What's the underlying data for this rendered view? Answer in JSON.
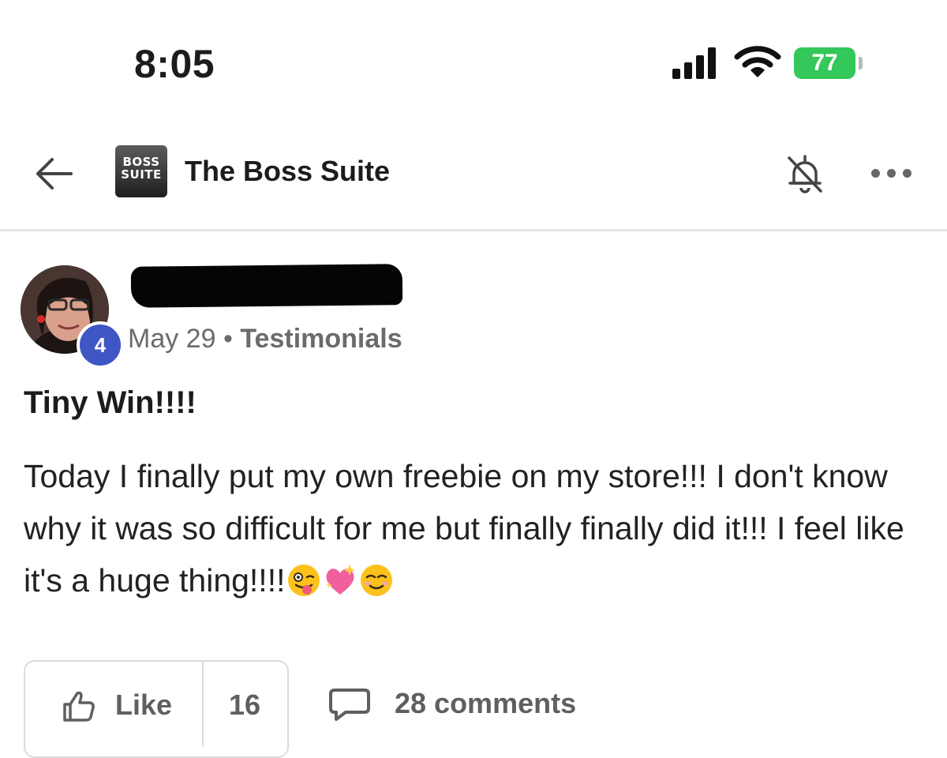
{
  "status_bar": {
    "time": "8:05",
    "battery_level": "77",
    "battery_color": "#34c759"
  },
  "header": {
    "back_icon": "arrow-left-icon",
    "group_logo_line1": "BOSS",
    "group_logo_line2": "SUITE",
    "group_name": "The Boss Suite",
    "bell_icon": "bell-muted-icon",
    "more_icon": "more-dots-icon"
  },
  "post": {
    "level": "4",
    "date": "May 29",
    "separator": "•",
    "category": "Testimonials",
    "title": "Tiny Win!!!!",
    "body": "Today I finally put my own freebie on my store!!! I don't know why it was so difficult for me but finally finally did it!!! I feel like it's a huge thing!!!!",
    "emojis": [
      "winking-face-with-tongue",
      "sparkling-heart",
      "smiling-face"
    ]
  },
  "actions": {
    "like_label": "Like",
    "like_count": "16",
    "comments_label": "28 comments"
  },
  "colors": {
    "level_badge": "#3f57c4",
    "text_secondary": "#6b6b6b"
  }
}
